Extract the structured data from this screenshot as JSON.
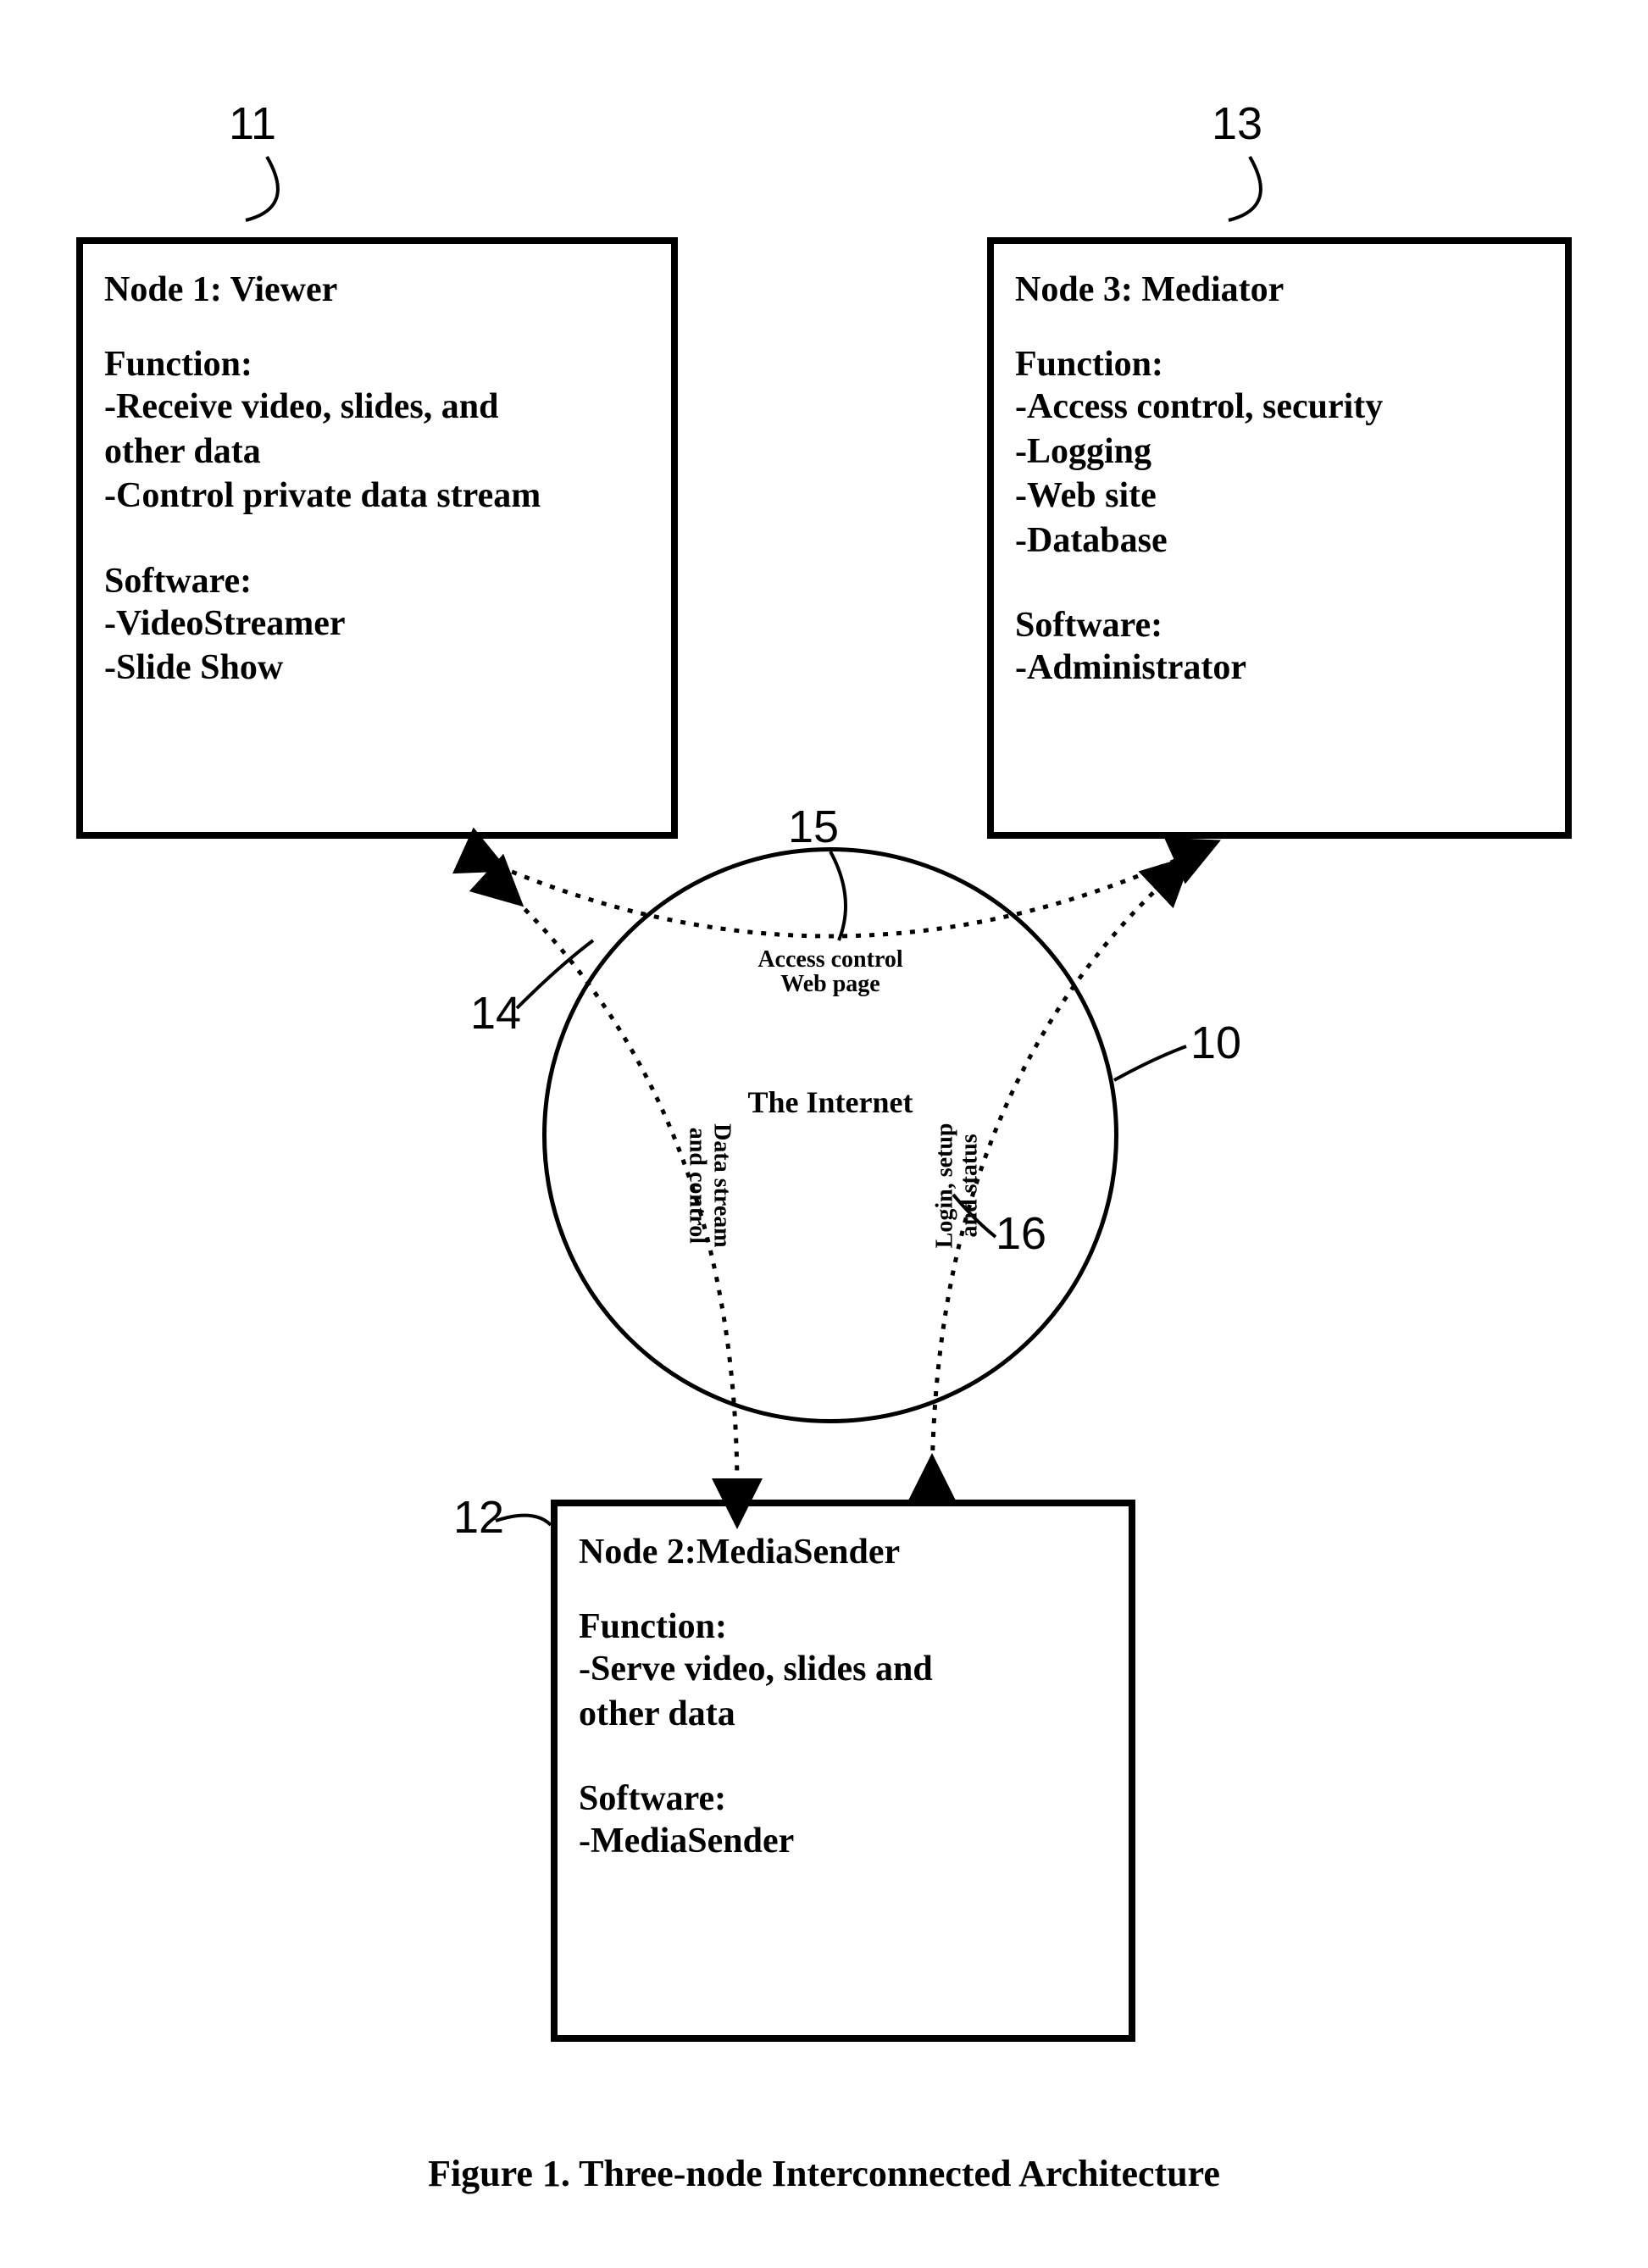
{
  "node1": {
    "title": "Node 1: Viewer",
    "function_label": "Function:",
    "functions": [
      "-Receive video, slides, and",
      " other data",
      "-Control private data stream"
    ],
    "software_label": "Software:",
    "software": [
      "-VideoStreamer",
      "-Slide Show"
    ]
  },
  "node2": {
    "title": "Node 2:MediaSender",
    "function_label": "Function:",
    "functions": [
      "-Serve video, slides and",
      "other data"
    ],
    "software_label": "Software:",
    "software": [
      "-MediaSender"
    ]
  },
  "node3": {
    "title": "Node 3: Mediator",
    "function_label": "Function:",
    "functions": [
      "-Access control, security",
      "-Logging",
      "-Web site",
      "-Database"
    ],
    "software_label": "Software:",
    "software": [
      "-Administrator"
    ]
  },
  "center": {
    "label": "The Internet",
    "top_label_line1": "Access control",
    "top_label_line2": "Web page",
    "left_label_line1": "Data stream",
    "left_label_line2": "and control",
    "right_label_line1": "Login, setup",
    "right_label_line2": "and status"
  },
  "refs": {
    "r10": "10",
    "r11": "11",
    "r12": "12",
    "r13": "13",
    "r14": "14",
    "r15": "15",
    "r16": "16"
  },
  "caption": "Figure 1. Three-node Interconnected Architecture"
}
